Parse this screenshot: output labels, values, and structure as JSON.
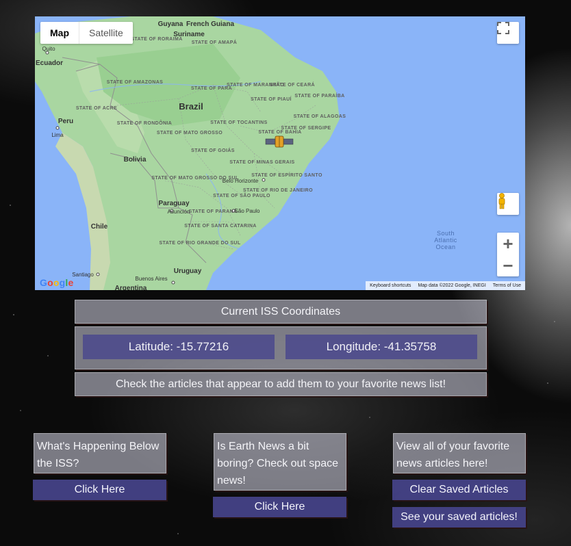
{
  "map": {
    "type_control": {
      "map_label": "Map",
      "satellite_label": "Satellite"
    },
    "labels": {
      "countries": [
        "Guyana",
        "Suriname",
        "French Guiana",
        "Ecuador",
        "Peru",
        "Brazil",
        "Bolivia",
        "Paraguay",
        "Chile",
        "Uruguay",
        "Argentina"
      ],
      "cities": [
        "Quito",
        "Lima",
        "Belo Horizonte",
        "São Paulo",
        "Asunción",
        "Santiago",
        "Buenos Aires"
      ],
      "states": [
        "STATE OF RORAIMA",
        "STATE OF AMAPÁ",
        "STATE OF AMAZONAS",
        "STATE OF PARÁ",
        "STATE OF MARANHÃO",
        "STATE OF CEARÁ",
        "STATE OF PIAUÍ",
        "STATE OF PARAÍBA",
        "STATE OF ALAGOAS",
        "STATE OF SERGIPE",
        "STATE OF ACRE",
        "STATE OF RONDÔNIA",
        "STATE OF TOCANTINS",
        "STATE OF MATO GROSSO",
        "STATE OF GOIÁS",
        "STATE OF BAHIA",
        "STATE OF MINAS GERAIS",
        "STATE OF ESPÍRITO SANTO",
        "STATE OF MATO GROSSO DO SUL",
        "STATE OF RIO DE JANEIRO",
        "STATE OF SÃO PAULO",
        "STATE OF PARANÁ",
        "STATE OF SANTA CATARINA",
        "STATE OF RIO GRANDE DO SUL"
      ],
      "ocean": "South Atlantic Ocean"
    },
    "google_logo": "Google",
    "attribution": {
      "shortcuts": "Keyboard shortcuts",
      "map_data": "Map data ©2022 Google, INEGI",
      "terms": "Terms of Use"
    },
    "icons": {
      "fullscreen": "fullscreen-icon",
      "pegman": "pegman-icon",
      "zoom_in": "+",
      "zoom_out": "−",
      "marker": "satellite-icon"
    }
  },
  "iss": {
    "title": "Current ISS Coordinates",
    "latitude": "Latitude: -15.77216",
    "longitude": "Longitude: -41.35758",
    "hint": "Check the articles that appear to add them to your favorite news list!"
  },
  "cards": {
    "earth": {
      "text": "What's Happening Below the ISS?",
      "button": "Click Here"
    },
    "space": {
      "text": "Is Earth News a bit boring? Check out space news!",
      "button": "Click Here"
    },
    "favorites": {
      "text": "View all of your favorite news articles here!",
      "clear_button": "Clear Saved Articles",
      "saved_button": "See your saved articles!"
    }
  },
  "colors": {
    "button": "#444287",
    "coord_box": "#4e4c8c",
    "map_land": "#a9d6a1",
    "map_water": "#8ab4f8"
  }
}
